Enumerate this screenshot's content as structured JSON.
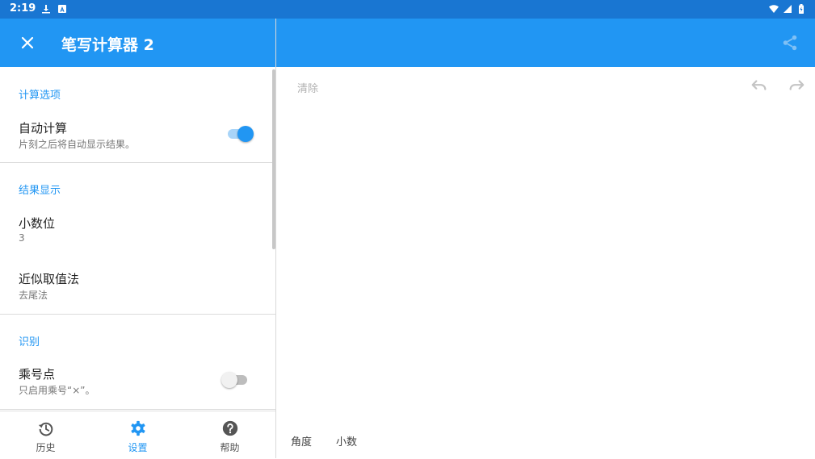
{
  "status_bar": {
    "time": "2:19",
    "left_icons": [
      "download-icon",
      "notification-a-icon"
    ],
    "right_icons": [
      "wifi-icon",
      "signal-icon",
      "battery-icon"
    ],
    "background": "#1976d2"
  },
  "app_bar": {
    "title": "笔写计算器 2",
    "close_icon": "close-icon",
    "share_icon": "share-icon",
    "background": "#2196f3"
  },
  "settings": {
    "calc_options": {
      "header": "计算选项",
      "auto_calc": {
        "title": "自动计算",
        "subtitle": "片刻之后将自动显示结果。",
        "enabled": true
      }
    },
    "result_display": {
      "header": "结果显示",
      "decimal_places": {
        "title": "小数位",
        "value": "3"
      },
      "rounding": {
        "title": "近似取值法",
        "value": "去尾法"
      }
    },
    "recognition": {
      "header": "识别",
      "multiply_dot": {
        "title": "乘号点",
        "subtitle": "只启用乘号“×”。",
        "enabled": false
      }
    }
  },
  "bottom_nav": {
    "items": [
      {
        "label": "历史",
        "icon": "history-icon",
        "active": false
      },
      {
        "label": "设置",
        "icon": "gear-icon",
        "active": true
      },
      {
        "label": "帮助",
        "icon": "help-icon",
        "active": false
      }
    ]
  },
  "canvas": {
    "clear_label": "清除",
    "undo_icon": "undo-icon",
    "redo_icon": "redo-icon",
    "modes": {
      "angle": "角度",
      "decimal": "小数"
    }
  },
  "colors": {
    "accent": "#2196f3",
    "status_bar": "#1976d2",
    "toggle_track_on": "#a8d4f8"
  }
}
